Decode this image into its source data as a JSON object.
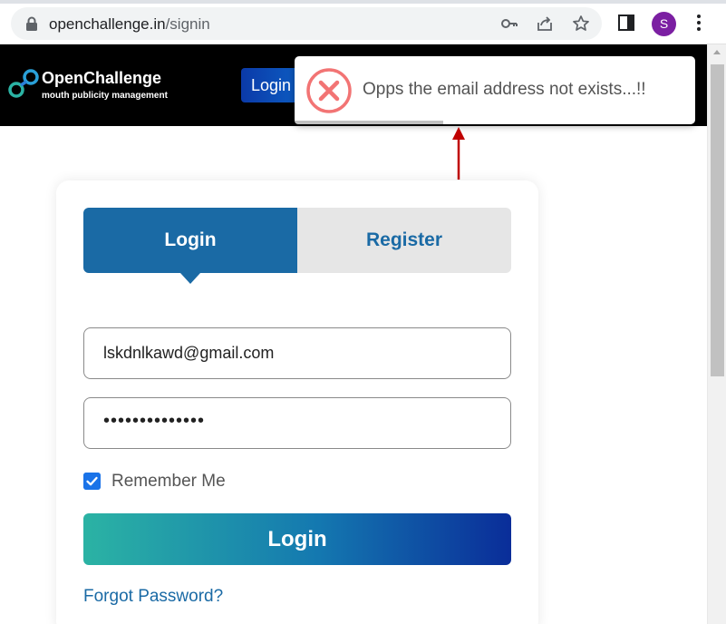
{
  "browser": {
    "url_host": "openchallenge.in",
    "url_path": "/signin",
    "profile_initial": "S",
    "icons": [
      "lock-icon",
      "key-icon",
      "share-icon",
      "star-icon",
      "side-panel-icon",
      "menu-dots-icon"
    ]
  },
  "header": {
    "brand_name": "OpenChallenge",
    "brand_tagline": "mouth publicity management",
    "login_button": "Login"
  },
  "toast": {
    "message": "Opps the email address not exists...!!",
    "icon": "error-x-icon",
    "progress": 0.37
  },
  "auth": {
    "tab_login": "Login",
    "tab_register": "Register",
    "active_tab": "Login",
    "email_value": "lskdnlkawd@gmail.com",
    "password_mask": "••••••••••••••",
    "remember_label": "Remember Me",
    "remember_checked": true,
    "submit_label": "Login",
    "forgot_label": "Forgot Password?"
  },
  "colors": {
    "brand_blue": "#1a6aa5",
    "error_red": "#f27474",
    "checkbox_blue": "#1a73e8"
  }
}
